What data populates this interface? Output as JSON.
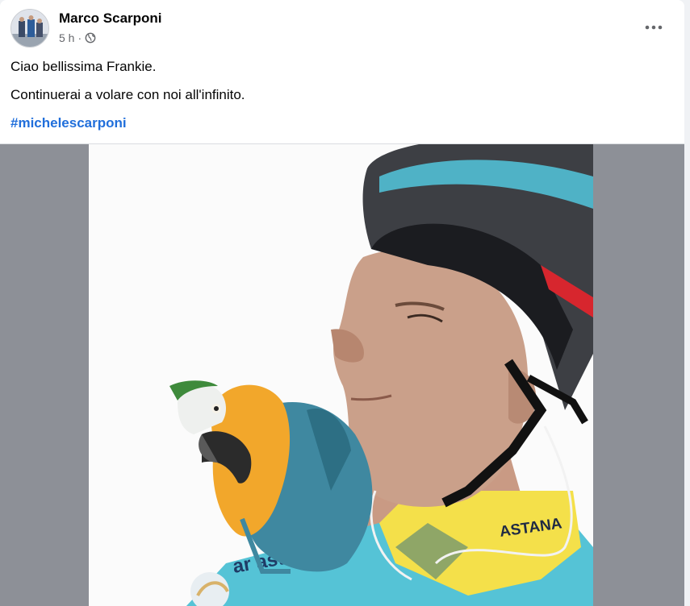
{
  "post": {
    "author": "Marco Scarponi",
    "time": "5 h",
    "separator": "·",
    "privacy_icon": "globe-icon",
    "more_icon": "more-horizontal-icon",
    "lines": [
      "Ciao bellissima Frankie.",
      "Continuerai a volare con noi all'infinito."
    ],
    "hashtag": "#michelescarponi"
  },
  "photo": {
    "jersey_text": "ASTANA",
    "jersey_front_text": "ar asta",
    "colors": {
      "background": "#fbfbfb",
      "jersey": "#55c3d6",
      "collar": "#f4e04a",
      "helmet": "#3d3f44",
      "helmet_stripe": "#4fb2c6",
      "skin": "#caa08a",
      "parrot_back": "#3f88a0",
      "parrot_chest": "#f2a72b"
    }
  },
  "theme": {
    "hashtag_color": "#216fdb",
    "meta_color": "#65676b",
    "media_bg": "#8d9097"
  }
}
